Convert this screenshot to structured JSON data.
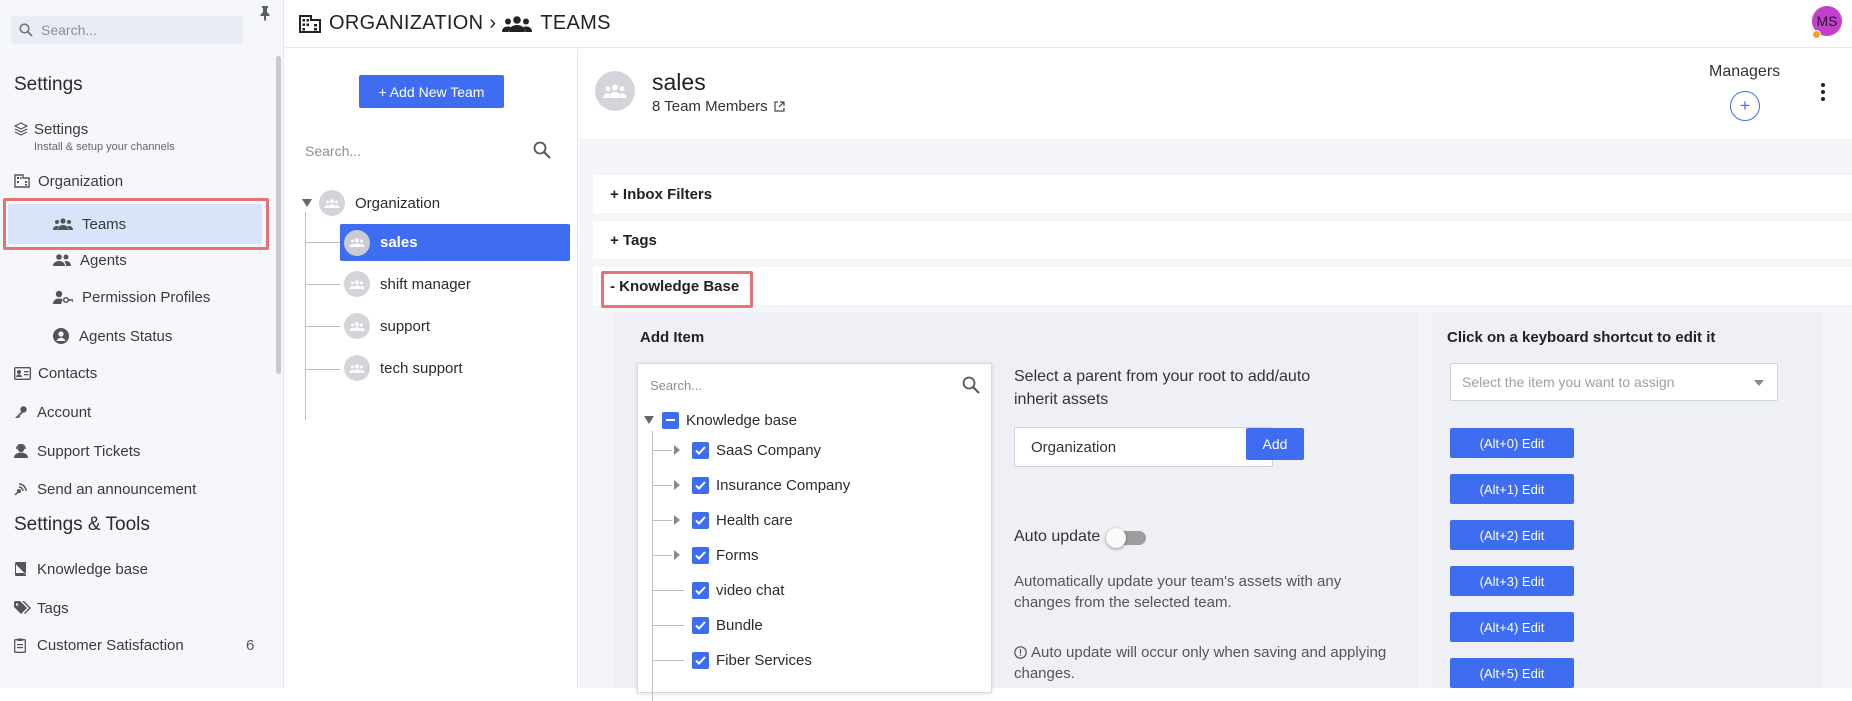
{
  "sidebar": {
    "search_placeholder": "Search...",
    "pin_icon": "pin-icon",
    "headings": {
      "settings": "Settings",
      "tools": "Settings & Tools"
    },
    "items": [
      {
        "label": "Settings",
        "icon": "layers-icon",
        "sub": "Install & setup your channels"
      },
      {
        "label": "Organization",
        "icon": "building-icon"
      },
      {
        "label": "Teams",
        "icon": "team-icon",
        "active": true
      },
      {
        "label": "Agents",
        "icon": "users-icon"
      },
      {
        "label": "Permission Profiles",
        "icon": "user-key-icon"
      },
      {
        "label": "Agents Status",
        "icon": "agent-status-icon"
      },
      {
        "label": "Contacts",
        "icon": "contact-card-icon"
      },
      {
        "label": "Account",
        "icon": "key-icon"
      },
      {
        "label": "Support Tickets",
        "icon": "support-agent-icon"
      },
      {
        "label": "Send an announcement",
        "icon": "broadcast-icon"
      },
      {
        "label": "Knowledge base",
        "icon": "book-icon"
      },
      {
        "label": "Tags",
        "icon": "tags-icon"
      },
      {
        "label": "Customer Satisfaction",
        "icon": "clipboard-icon",
        "count": "6"
      }
    ]
  },
  "header": {
    "crumb_root": "ORGANIZATION",
    "crumb_sep": "›",
    "crumb_current": "TEAMS",
    "avatar_initials": "MS",
    "avatar_color": "#c341c8"
  },
  "teams": {
    "add_button": "+ Add New Team",
    "search_placeholder": "Search...",
    "root": "Organization",
    "list": [
      "sales",
      "shift manager",
      "support",
      "tech support"
    ],
    "selected": "sales"
  },
  "team": {
    "name": "sales",
    "members": "8 Team Members",
    "managers_label": "Managers",
    "managers_add": "+"
  },
  "sections": {
    "inbox_filters": "+ Inbox Filters",
    "tags": "+ Tags",
    "knowledge_base": "- Knowledge Base"
  },
  "kb": {
    "add_item_title": "Add Item",
    "search_placeholder": "Search...",
    "root": "Knowledge base",
    "items": [
      {
        "label": "SaaS Company",
        "expandable": true
      },
      {
        "label": "Insurance Company",
        "expandable": true
      },
      {
        "label": "Health care",
        "expandable": true
      },
      {
        "label": "Forms",
        "expandable": true
      },
      {
        "label": "video chat",
        "expandable": false
      },
      {
        "label": "Bundle",
        "expandable": false
      },
      {
        "label": "Fiber Services",
        "expandable": false
      }
    ],
    "parent_text": "Select a parent from your root to add/auto inherit assets",
    "parent_value": "Organization",
    "add_button": "Add",
    "auto_update_label": "Auto update",
    "auto_update_on": false,
    "auto_update_desc": "Automatically update your team's assets with any changes from the selected team.",
    "auto_update_note": "Auto update will occur only when saving and applying changes."
  },
  "shortcuts": {
    "title": "Click on a keyboard shortcut to edit it",
    "select_placeholder": "Select the item you want to assign",
    "buttons": [
      "(Alt+0) Edit",
      "(Alt+1) Edit",
      "(Alt+2) Edit",
      "(Alt+3) Edit",
      "(Alt+4) Edit",
      "(Alt+5) Edit"
    ]
  },
  "colors": {
    "accent": "#3f6df2",
    "sidebar_bg": "#f6f7fb",
    "active_item_bg": "#d9e4fb",
    "highlight_outline": "#e57373"
  }
}
